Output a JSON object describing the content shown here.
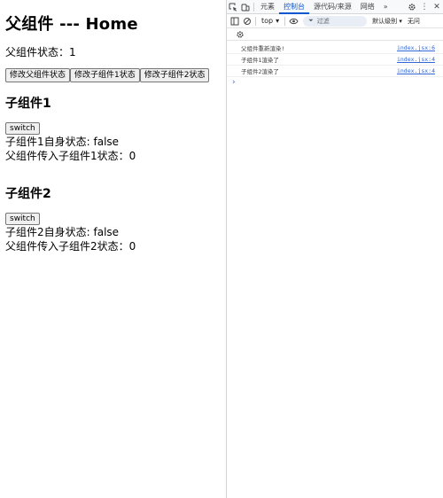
{
  "app": {
    "title": "父组件 --- Home",
    "parent_state": "父组件状态：1",
    "buttons": {
      "modify_parent": "修改父组件状态",
      "modify_child1": "修改子组件1状态",
      "modify_child2": "修改子组件2状态"
    },
    "child1": {
      "title": "子组件1",
      "switch_label": "switch",
      "self_state": "子组件1自身状态: false",
      "passed_state": "父组件传入子组件1状态：0"
    },
    "child2": {
      "title": "子组件2",
      "switch_label": "switch",
      "self_state": "子组件2自身状态: false",
      "passed_state": "父组件传入子组件2状态：0"
    }
  },
  "devtools": {
    "tabs": [
      "元素",
      "控制台",
      "源代码/来源",
      "网络"
    ],
    "active_tab": "控制台",
    "more_tabs": "»",
    "context_select": "top",
    "filter_placeholder": "过滤",
    "levels_label": "默认级别",
    "issues_label": "无问",
    "logs": [
      {
        "message": "父组件重新渲染!",
        "source": "index.jsx:6"
      },
      {
        "message": "子组件1渲染了",
        "source": "index.jsx:4"
      },
      {
        "message": "子组件2渲染了",
        "source": "index.jsx:4"
      }
    ],
    "prompt": "›",
    "accent": "#0b57d0",
    "link_color": "#3367d6"
  }
}
